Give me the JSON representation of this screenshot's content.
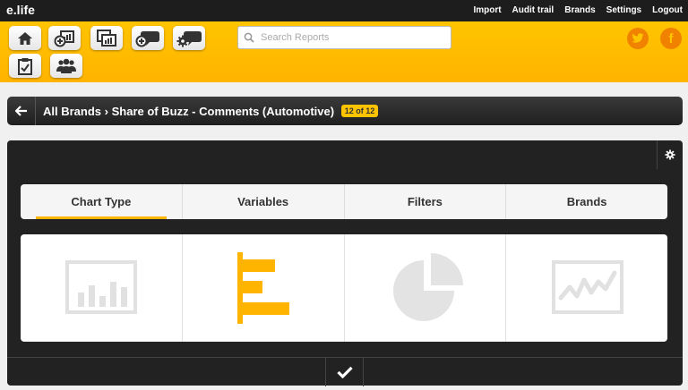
{
  "app": {
    "logo": "e.life"
  },
  "topnav": [
    "Import",
    "Audit trail",
    "Brands",
    "Settings",
    "Logout"
  ],
  "toolbar": {
    "buttons": [
      "home-icon",
      "add-report-icon",
      "reports-icon",
      "add-comment-icon",
      "comment-settings-icon",
      "checklist-icon",
      "users-icon"
    ],
    "search_placeholder": "Search Reports",
    "social": {
      "twitter": "t",
      "facebook": "f"
    }
  },
  "breadcrumb": {
    "root": "All Brands",
    "separator": "›",
    "current": "Share of Buzz - Comments (Automotive)",
    "badge": "12 of 12"
  },
  "tabs": [
    "Chart Type",
    "Variables",
    "Filters",
    "Brands"
  ],
  "active_tab": "Chart Type",
  "chart_types": [
    "bar-chart-icon",
    "horizontal-bar-icon",
    "pie-chart-icon",
    "line-chart-icon"
  ],
  "selected_chart_type": "horizontal-bar-icon",
  "colors": {
    "accent": "#ffb400",
    "dark": "#222222"
  }
}
